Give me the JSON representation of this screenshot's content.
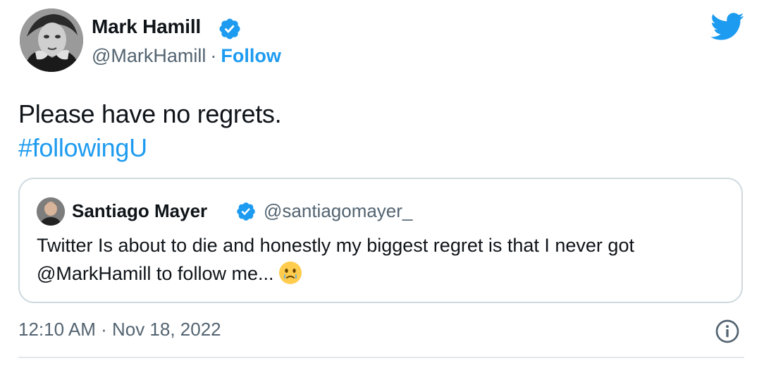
{
  "author": {
    "name": "Mark Hamill",
    "handle": "@MarkHamill",
    "separator": "·",
    "follow_label": "Follow"
  },
  "tweet": {
    "text": "Please have no regrets.",
    "hashtag": "#followingU"
  },
  "quoted_tweet": {
    "name": "Santiago Mayer",
    "handle": "@santiagomayer_",
    "text": "Twitter Is about to die and honestly my biggest regret is that I never got @MarkHamill to follow me...",
    "emoji": "face-holding-back-tears-icon"
  },
  "meta": {
    "timestamp": "12:10 AM · Nov 18, 2022"
  },
  "icons": {
    "verified": "verified-badge-icon",
    "logo": "twitter-bird-icon",
    "info": "info-icon"
  },
  "colors": {
    "accent": "#1d9bf0",
    "text": "#0f1419",
    "secondary": "#536471",
    "border": "#cfd9de"
  }
}
